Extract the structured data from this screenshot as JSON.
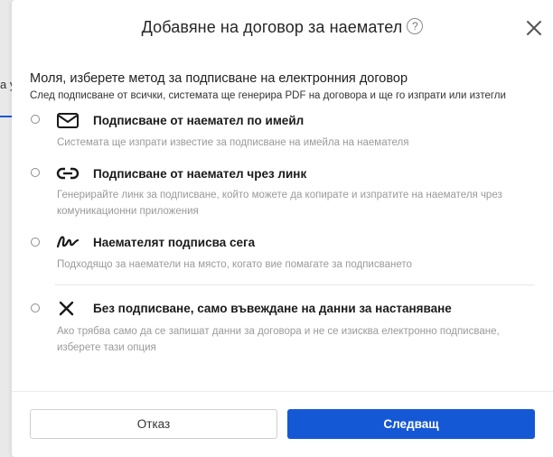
{
  "backdrop": {
    "text": "а у"
  },
  "dialog": {
    "title": "Добавяне на договор за наемател",
    "help_symbol": "?"
  },
  "intro": {
    "title": "Моля, изберете метод за подписване на електронния договор",
    "subtitle": "След подписване от всички, системата ще генерира PDF на договора и ще го изпрати или изтегли"
  },
  "options": [
    {
      "icon": "envelope-icon",
      "title": "Подписване от наемател по имейл",
      "description": "Системата ще изпрати известие за подписване на имейла на наемателя",
      "selected": false
    },
    {
      "icon": "link-icon",
      "title": "Подписване от наемател чрез линк",
      "description": "Генерирайте линк за подписване, който можете да копирате и изпратите на наемателя чрез комуникационни приложения",
      "selected": false
    },
    {
      "icon": "signature-icon",
      "title": "Наемателят подписва сега",
      "description": "Подходящо за наематели на място, когато вие помагате за подписването",
      "selected": false
    },
    {
      "icon": "cross-icon",
      "title": "Без подписване, само въвеждане на данни за настаняване",
      "description": "Ако трябва само да се запишат данни за договора и не се изисква електронно подписване, изберете тази опция",
      "selected": false
    }
  ],
  "footer": {
    "cancel_label": "Отказ",
    "next_label": "Следващ"
  },
  "colors": {
    "primary": "#1558d6",
    "description_text": "#9a9a9a"
  }
}
